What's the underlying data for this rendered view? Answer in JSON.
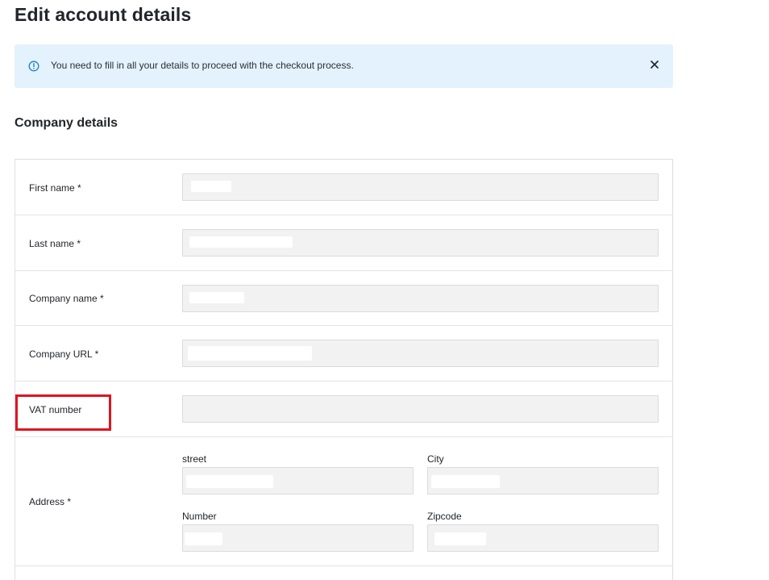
{
  "page": {
    "title": "Edit account details"
  },
  "alert": {
    "icon": "info-circle-icon",
    "message": "You need to fill in all your details to proceed with the checkout process.",
    "close_icon": "close-icon",
    "colors": {
      "background": "#e3f2fc",
      "icon": "#1e7fc4"
    }
  },
  "company_section": {
    "title": "Company details",
    "fields": {
      "first_name": {
        "label": "First name *",
        "value": ""
      },
      "last_name": {
        "label": "Last name *",
        "value": ""
      },
      "company_name": {
        "label": "Company name *",
        "value": ""
      },
      "company_url": {
        "label": "Company URL *",
        "value": ""
      },
      "vat_number": {
        "label": "VAT number",
        "value": ""
      }
    },
    "address": {
      "label": "Address *",
      "street_label": "street",
      "city_label": "City",
      "number_label": "Number",
      "zipcode_label": "Zipcode"
    }
  },
  "annotation": {
    "highlight_color": "#e0141e"
  }
}
